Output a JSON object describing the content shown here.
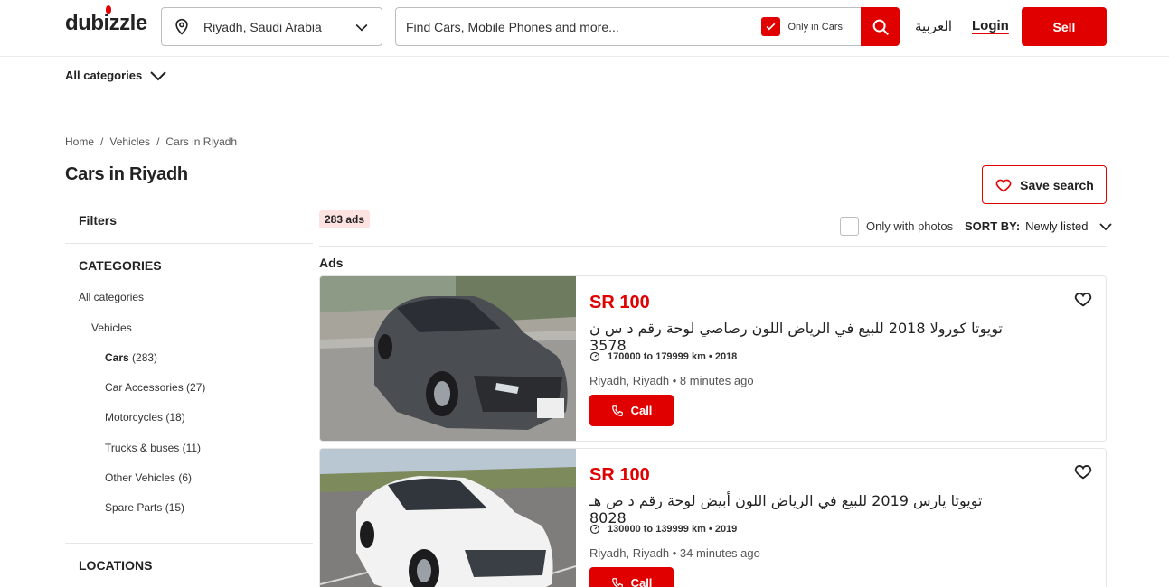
{
  "header": {
    "logo": "dubizzle",
    "location": "Riyadh, Saudi Arabia",
    "search_placeholder": "Find Cars, Mobile Phones and more...",
    "only_in_cars": "Only in Cars",
    "language": "العربية",
    "login": "Login",
    "sell": "Sell"
  },
  "nav": {
    "all_categories": "All categories"
  },
  "breadcrumb": [
    "Home",
    "/",
    "Vehicles",
    "/",
    "Cars in Riyadh"
  ],
  "page_title": "Cars in Riyadh",
  "save_search": "Save search",
  "sidebar": {
    "filters": "Filters",
    "categories_title": "CATEGORIES",
    "all_categories": "All categories",
    "vehicles": "Vehicles",
    "cars_label": "Cars",
    "cars_count": "(283)",
    "subcategories": [
      "Car Accessories (27)",
      "Motorcycles (18)",
      "Trucks & buses (11)",
      "Other Vehicles (6)",
      "Spare Parts (15)"
    ],
    "locations_title": "LOCATIONS"
  },
  "results": {
    "count_badge": "283 ads",
    "only_with_photos": "Only with photos",
    "sort_label": "SORT BY:",
    "sort_value": "Newly listed",
    "ads_label": "Ads"
  },
  "listings": [
    {
      "price": "SR 100",
      "title": "تويوتا كورولا 2018 للبيع في الرياض اللون رصاصي لوحة رقم د س ن 3578",
      "specs": "170000 to 179999 km • 2018",
      "location": "Riyadh, Riyadh • 8 minutes ago",
      "call": "Call",
      "car_color": "#4a4d52"
    },
    {
      "price": "SR 100",
      "title": "تويوتا يارس 2019 للبيع في الرياض اللون أبيض لوحة رقم د ص هـ 8028",
      "specs": "130000 to 139999 km • 2019",
      "location": "Riyadh, Riyadh • 34 minutes ago",
      "call": "Call",
      "car_color": "#f2f2f2"
    }
  ],
  "colors": {
    "brand_red": "#e00000",
    "badge_bg": "#fde2e2"
  }
}
